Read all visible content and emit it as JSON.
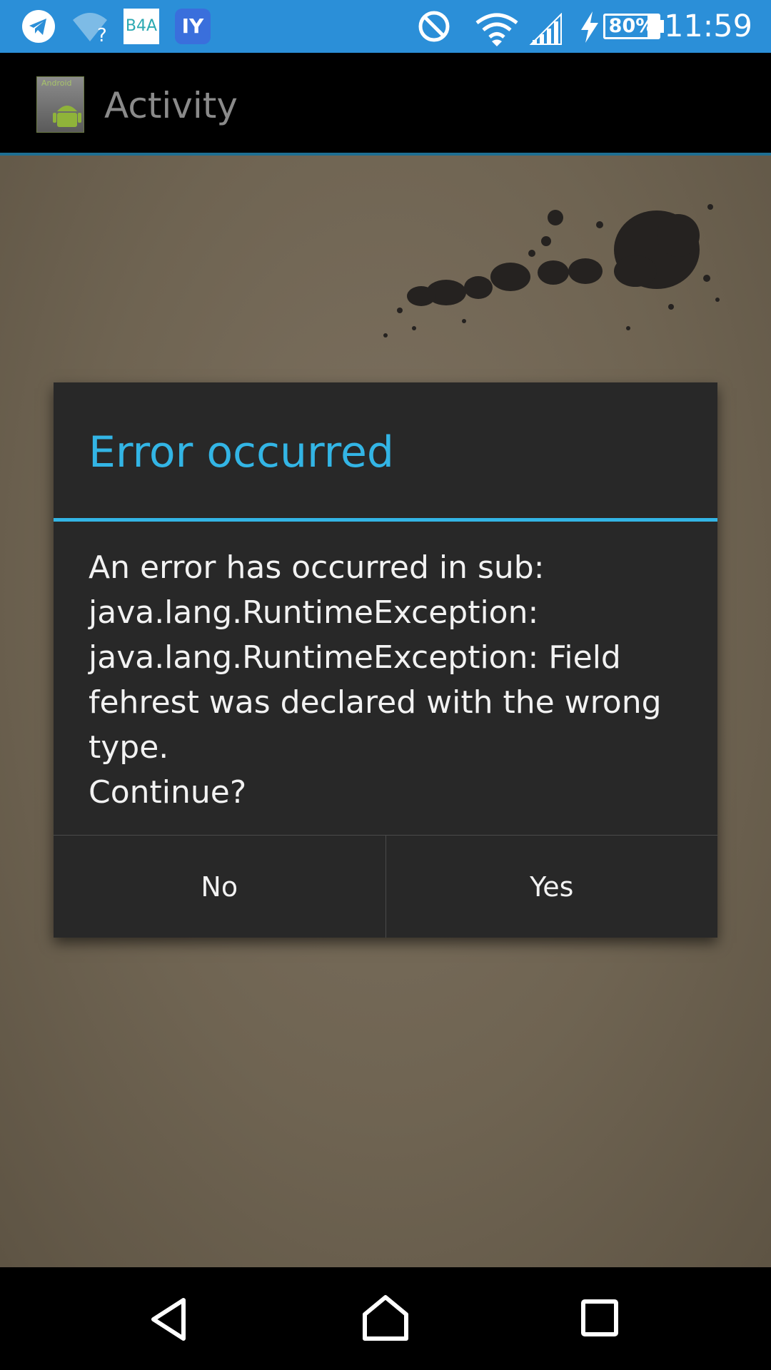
{
  "status_bar": {
    "icons": [
      "telegram-icon",
      "wifi-question-icon",
      "b4a-icon",
      "iy-icon",
      "do-not-disturb-icon",
      "wifi-icon",
      "signal-icon",
      "charging-icon"
    ],
    "b4a_label": "B4A",
    "iy_label": "IY",
    "battery_percent": "80%",
    "battery_level": 0.8,
    "clock": "11:59",
    "background_color": "#2b8fd8"
  },
  "action_bar": {
    "title": "Activity",
    "app_icon_label": "Android"
  },
  "dialog": {
    "title": "Error occurred",
    "message": "An error has occurred in sub:\njava.lang.RuntimeException:\njava.lang.RuntimeException: Field fehrest was declared with the wrong type.\nContinue?",
    "negative_label": "No",
    "positive_label": "Yes",
    "accent_color": "#33b5e5"
  },
  "nav_bar": {
    "icons": [
      "back-icon",
      "home-icon",
      "recents-icon"
    ]
  }
}
